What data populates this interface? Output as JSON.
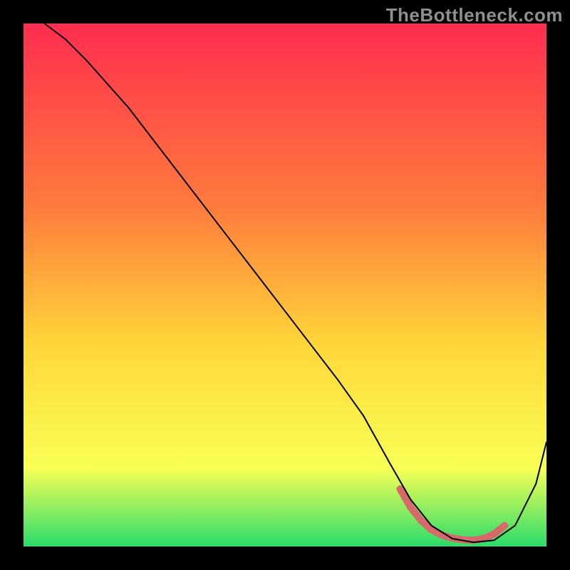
{
  "watermark": "TheBottleneck.com",
  "chart_data": {
    "type": "line",
    "title": "",
    "xlabel": "",
    "ylabel": "",
    "xlim": [
      0,
      100
    ],
    "ylim": [
      0,
      100
    ],
    "background_gradient": {
      "top": "#ff2d4f",
      "upper_mid": "#ff7b3c",
      "mid": "#ffd83a",
      "lower_mid": "#f8ff55",
      "bottom": "#2bdc6a"
    },
    "series": [
      {
        "name": "curve",
        "stroke": "#000000",
        "stroke_width": 2,
        "x": [
          4,
          8,
          12,
          20,
          30,
          40,
          50,
          60,
          65,
          70,
          74,
          78,
          82,
          86,
          90,
          94,
          98,
          100
        ],
        "y": [
          100,
          97,
          93,
          84,
          71,
          58,
          45,
          32,
          25,
          16,
          9,
          4,
          1.5,
          0.8,
          1.2,
          4,
          12,
          20
        ]
      },
      {
        "name": "trough-marker",
        "stroke": "#d8696b",
        "stroke_width": 10,
        "stroke_linecap": "round",
        "x": [
          72,
          74,
          76,
          78,
          80,
          82,
          84,
          86,
          88,
          90,
          92
        ],
        "y": [
          11,
          7.5,
          5,
          3.2,
          2.2,
          1.6,
          1.3,
          1.2,
          1.5,
          2.4,
          4
        ]
      }
    ]
  }
}
